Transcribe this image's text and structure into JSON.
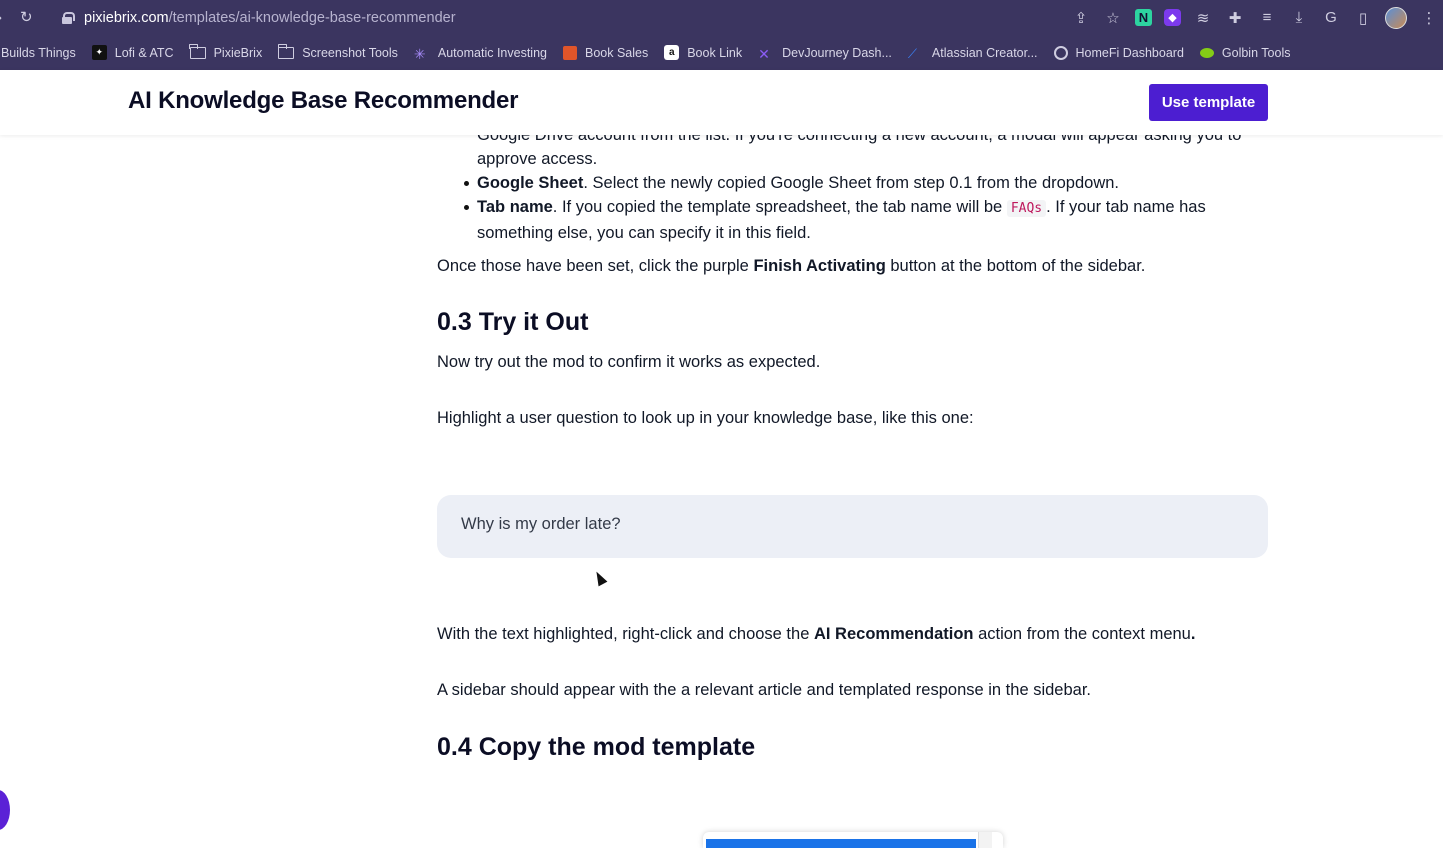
{
  "browser": {
    "url_host": "pixiebrix.com",
    "url_path": "/templates/ai-knowledge-base-recommender",
    "bookmarks": [
      {
        "label": "t Builds Things",
        "icon": "none"
      },
      {
        "label": "Lofi & ATC",
        "icon": "lofi-icon"
      },
      {
        "label": "PixieBrix",
        "icon": "folder-icon"
      },
      {
        "label": "Screenshot Tools",
        "icon": "folder-icon"
      },
      {
        "label": "Automatic Investing",
        "icon": "star-icon"
      },
      {
        "label": "Book Sales",
        "icon": "book-icon"
      },
      {
        "label": "Book Link",
        "icon": "amazon-icon"
      },
      {
        "label": "DevJourney Dash...",
        "icon": "devjourney-icon"
      },
      {
        "label": "Atlassian Creator...",
        "icon": "atlassian-icon"
      },
      {
        "label": "HomeFi Dashboard",
        "icon": "podcast-icon"
      },
      {
        "label": "Golbin Tools",
        "icon": "goblin-icon"
      }
    ]
  },
  "header": {
    "title": "AI Knowledge Base Recommender",
    "button_label": "Use template"
  },
  "content": {
    "list_cont": "Google Drive account from the list. If you're connecting a new account, a modal will appear asking you to approve access.",
    "li_sheet_bold": "Google Sheet",
    "li_sheet_text": ". Select the newly copied Google Sheet from step 0.1 from the dropdown.",
    "li_tab_bold": "Tab name",
    "li_tab_text1": ". If you copied the template spreadsheet, the tab name will be ",
    "li_tab_code": "FAQs",
    "li_tab_text2": ". If your tab name has something else, you can specify it in this field.",
    "finish_text1": "Once those have been set, click the purple ",
    "finish_bold": "Finish Activating",
    "finish_text2": " button at the bottom of the sidebar.",
    "h_try": "0.3 Try it Out",
    "try_text": "Now try out the mod to confirm it works as expected.",
    "highlight_text": "Highlight a user question to look up in your knowledge base, like this one:",
    "quote": "Why is my order late?",
    "rc_text1": "With the text highlighted, right-click and choose the ",
    "rc_bold": "AI Recommendation",
    "rc_text2": " action from the context menu",
    "rc_period": ".",
    "sidebar_text": "A sidebar should appear with the a relevant article and templated response in the sidebar.",
    "h_copy": "0.4 Copy the mod template"
  }
}
